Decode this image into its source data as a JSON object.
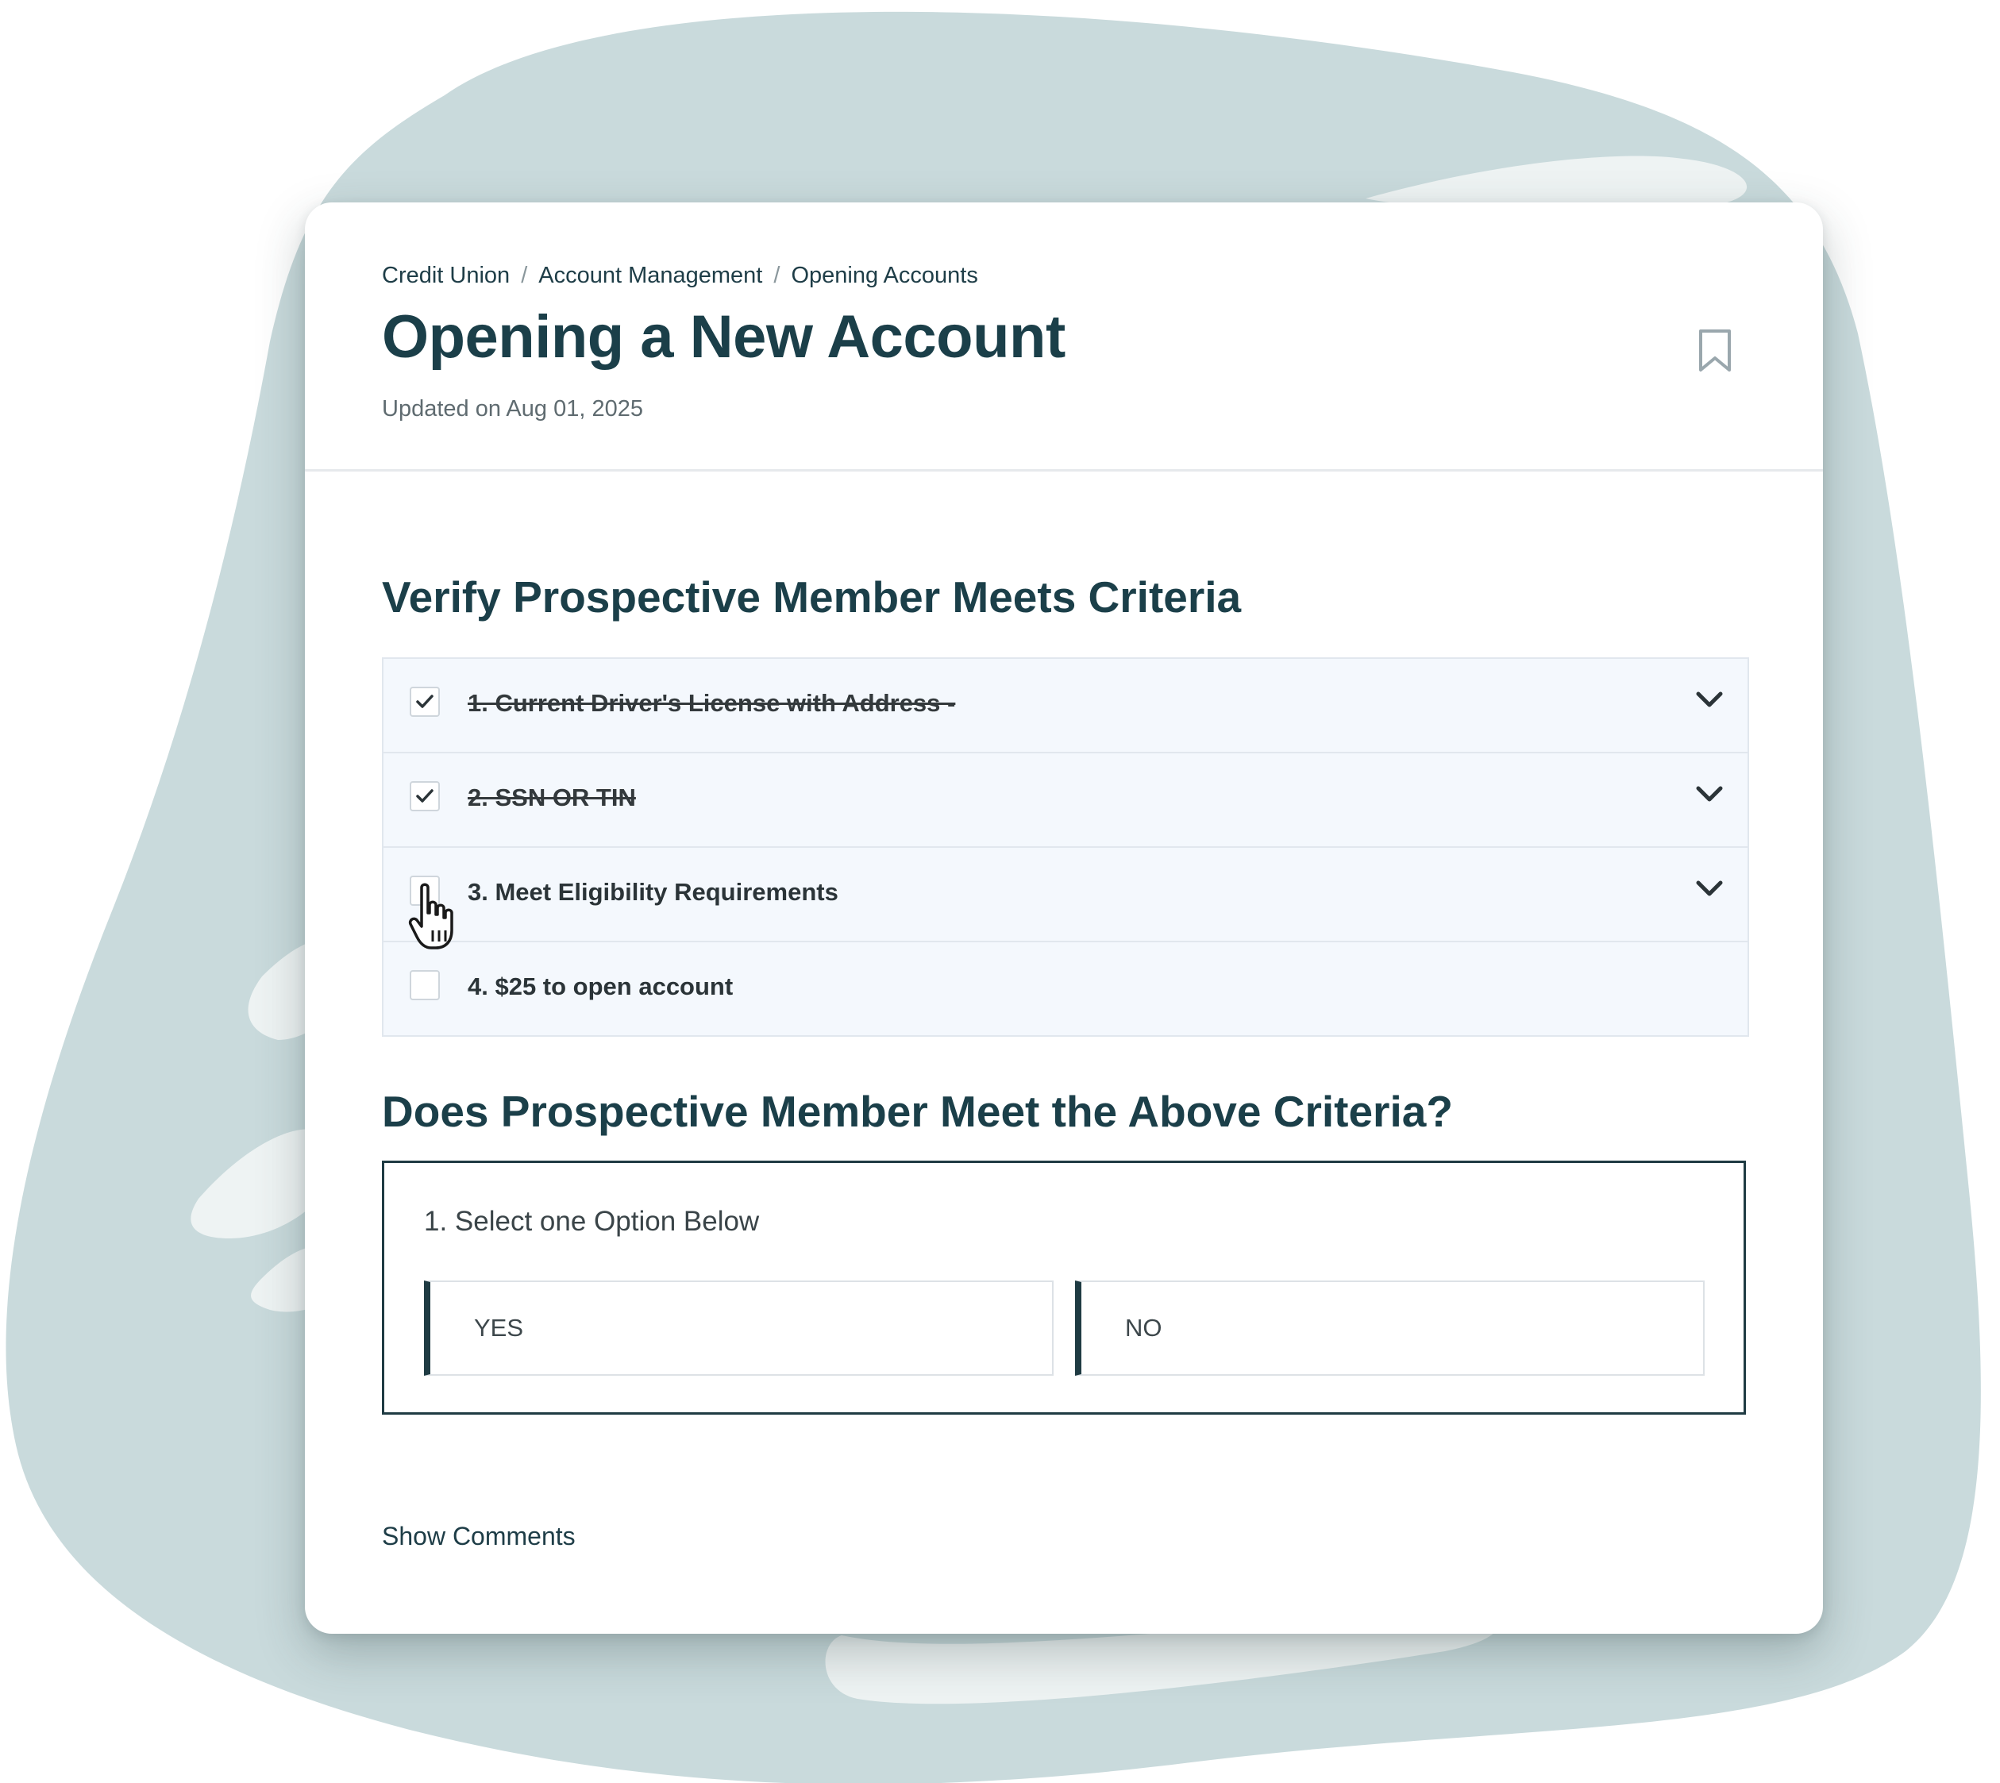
{
  "breadcrumb": [
    "Credit Union",
    "Account Management",
    "Opening Accounts"
  ],
  "header": {
    "title": "Opening a New Account",
    "updated": "Updated on Aug 01, 2025",
    "bookmark_icon": "bookmark-icon"
  },
  "criteria_section": {
    "title": "Verify Prospective Member Meets Criteria",
    "items": [
      {
        "label": "1. Current Driver's License with Address -",
        "checked": true,
        "expandable": true
      },
      {
        "label": "2. SSN OR TIN",
        "checked": true,
        "expandable": true
      },
      {
        "label": "3. Meet Eligibility Requirements",
        "checked": false,
        "expandable": true
      },
      {
        "label": "4. $25 to open account",
        "checked": false,
        "expandable": false
      }
    ]
  },
  "decision_section": {
    "title": "Does Prospective Member Meet the Above Criteria?",
    "prompt": "1. Select one Option Below",
    "options": [
      "YES",
      "NO"
    ]
  },
  "footer": {
    "show_comments": "Show Comments"
  },
  "colors": {
    "brand_dark": "#1b3f49",
    "background_blob": "#c9dadc",
    "checklist_bg": "#f4f8fd"
  }
}
